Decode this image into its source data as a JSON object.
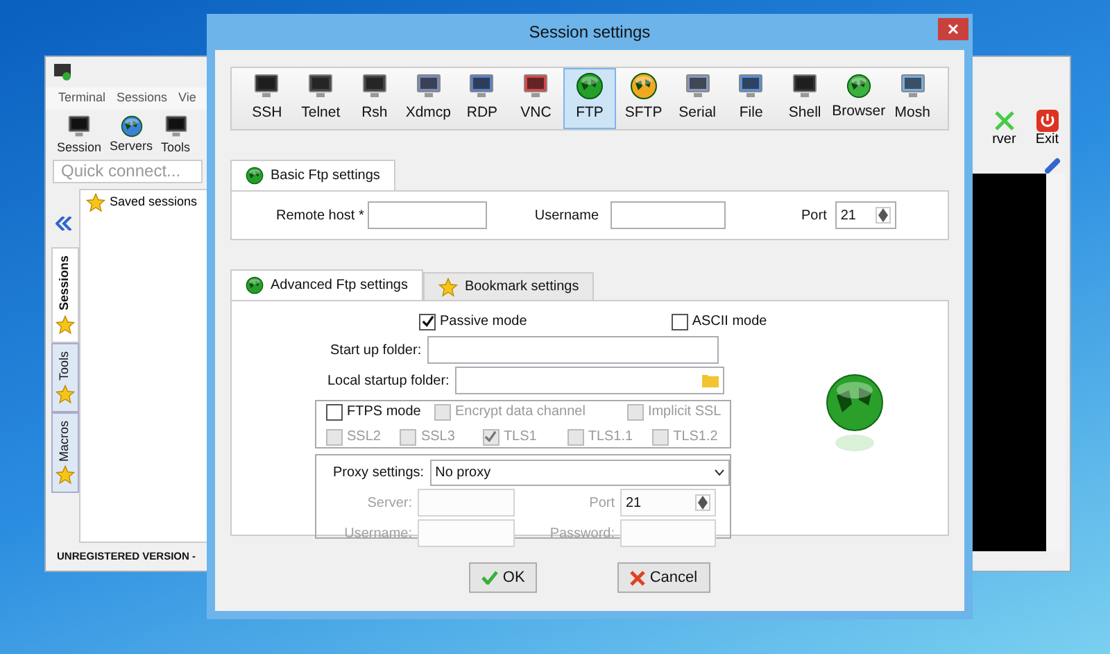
{
  "app_window": {
    "menu": [
      "Terminal",
      "Sessions",
      "Vie"
    ],
    "toolbar": [
      "Session",
      "Servers",
      "Tools"
    ],
    "toolbar_right": [
      "rver",
      "Exit"
    ],
    "quick_connect": {
      "placeholder": "Quick connect..."
    },
    "side_tabs": [
      {
        "label": "Sessions",
        "selected": true
      },
      {
        "label": "Tools",
        "selected": false
      },
      {
        "label": "Macros",
        "selected": false
      }
    ],
    "tree": [
      "Saved sessions"
    ],
    "status": "UNREGISTERED VERSION -"
  },
  "dialog": {
    "title": "Session settings",
    "protocols": [
      {
        "label": "SSH",
        "selected": false
      },
      {
        "label": "Telnet",
        "selected": false
      },
      {
        "label": "Rsh",
        "selected": false
      },
      {
        "label": "Xdmcp",
        "selected": false
      },
      {
        "label": "RDP",
        "selected": false
      },
      {
        "label": "VNC",
        "selected": false
      },
      {
        "label": "FTP",
        "selected": true
      },
      {
        "label": "SFTP",
        "selected": false
      },
      {
        "label": "Serial",
        "selected": false
      },
      {
        "label": "File",
        "selected": false
      },
      {
        "label": "Shell",
        "selected": false
      },
      {
        "label": "Browser",
        "selected": false
      },
      {
        "label": "Mosh",
        "selected": false
      }
    ],
    "basic_tab": "Basic Ftp settings",
    "remote_host": {
      "label": "Remote host *"
    },
    "username": {
      "label": "Username"
    },
    "port": {
      "label": "Port",
      "value": "21"
    },
    "tabs": [
      {
        "label": "Advanced Ftp settings",
        "selected": true
      },
      {
        "label": "Bookmark settings",
        "selected": false
      }
    ],
    "modes": [
      {
        "label": "Passive mode",
        "checked": true
      },
      {
        "label": "ASCII mode",
        "checked": false
      }
    ],
    "startup_folder": {
      "label": "Start up folder:"
    },
    "local_startup_folder": {
      "label": "Local startup folder:"
    },
    "ftps_mode": {
      "label": "FTPS mode",
      "checked": false
    },
    "ftps_options": [
      {
        "label": "Encrypt data channel",
        "checked": false,
        "disabled": true
      },
      {
        "label": "Implicit SSL",
        "checked": false,
        "disabled": true
      }
    ],
    "ssl_versions": [
      {
        "label": "SSL2",
        "checked": false,
        "disabled": true
      },
      {
        "label": "SSL3",
        "checked": false,
        "disabled": true
      },
      {
        "label": "TLS1",
        "checked": true,
        "disabled": true
      },
      {
        "label": "TLS1.1",
        "checked": false,
        "disabled": true
      },
      {
        "label": "TLS1.2",
        "checked": false,
        "disabled": true
      }
    ],
    "proxy": {
      "label": "Proxy settings:",
      "value": "No proxy"
    },
    "proxy_server": {
      "label": "Server:",
      "disabled": true
    },
    "proxy_port": {
      "label": "Port",
      "value": "21",
      "disabled": true
    },
    "proxy_username": {
      "label": "Username:",
      "disabled": true
    },
    "proxy_password": {
      "label": "Password:",
      "disabled": true
    },
    "buttons": [
      {
        "kind": "ok",
        "label": "OK"
      },
      {
        "kind": "cancel",
        "label": "Cancel"
      }
    ]
  }
}
